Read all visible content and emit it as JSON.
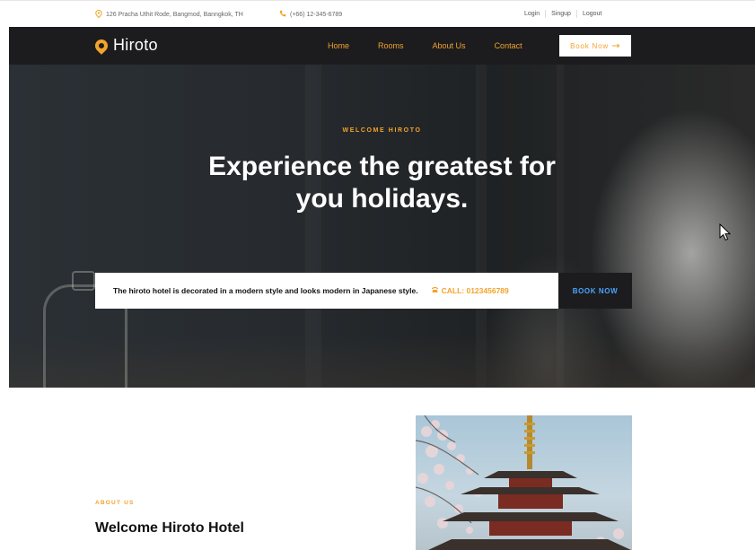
{
  "topbar": {
    "address": "126 Pracha Uthit Rode, Bangmod, Banngkok, TH",
    "phone": "(+66) 12-345-6789",
    "login": "Login",
    "signup": "Singup",
    "logout": "Logout"
  },
  "nav": {
    "brand": "Hiroto",
    "links": [
      "Home",
      "Rooms",
      "About Us",
      "Contact"
    ],
    "book_label": "Book Now"
  },
  "hero": {
    "eyebrow": "WELCOME HIROTO",
    "title_line1": "Experience the greatest for",
    "title_line2": "you holidays.",
    "info_text": "The hiroto hotel is decorated in a modern style and looks modern in Japanese style.",
    "call_label": "CALL: 0123456789",
    "book_label": "BOOK NOW"
  },
  "about": {
    "eyebrow": "ABOUT US",
    "title": "Welcome Hiroto Hotel"
  },
  "colors": {
    "accent": "#f2a32b",
    "dark": "#1c1c1e",
    "book_now_text": "#4aa3ff"
  },
  "icons": {
    "address": "location-pin-icon",
    "phone": "phone-icon",
    "brand": "map-pin-icon",
    "book_arrow": "arrow-right-icon",
    "call": "phone-icon",
    "cursor": "mouse-pointer-icon"
  }
}
